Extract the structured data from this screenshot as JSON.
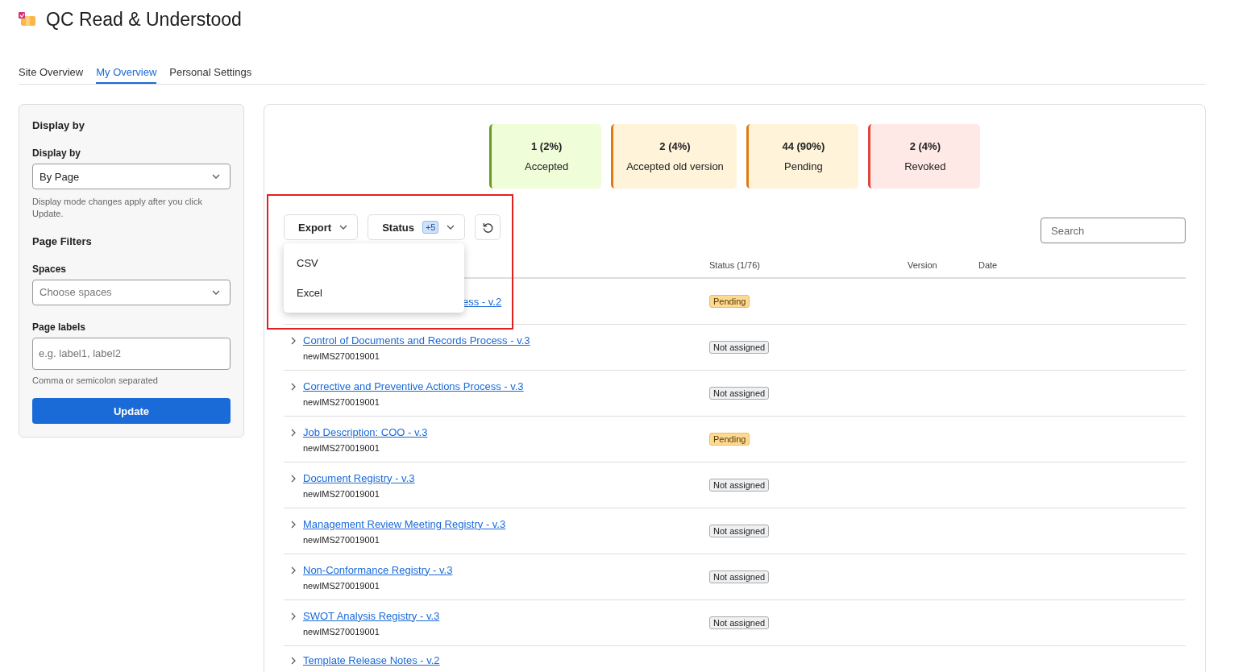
{
  "app": {
    "title": "QC Read & Understood"
  },
  "tabs": [
    {
      "label": "Site Overview",
      "selected": false
    },
    {
      "label": "My Overview",
      "selected": true
    },
    {
      "label": "Personal Settings",
      "selected": false
    }
  ],
  "sidebar": {
    "heading": "Display by",
    "display_label": "Display by",
    "display_value": "By Page",
    "display_hint": "Display mode changes apply after you click Update.",
    "filters_heading": "Page Filters",
    "spaces_label": "Spaces",
    "spaces_placeholder": "Choose spaces",
    "labels_label": "Page labels",
    "labels_placeholder": "e.g. label1, label2",
    "labels_hint": "Comma or semicolon separated",
    "update_button": "Update"
  },
  "stats": [
    {
      "count": "1 (2%)",
      "label": "Accepted",
      "kind": "accepted"
    },
    {
      "count": "2 (4%)",
      "label": "Accepted old version",
      "kind": "old"
    },
    {
      "count": "44 (90%)",
      "label": "Pending",
      "kind": "pending"
    },
    {
      "count": "2 (4%)",
      "label": "Revoked",
      "kind": "revoked"
    }
  ],
  "toolbar": {
    "export": "Export",
    "status": "Status",
    "status_count": "+5",
    "search_placeholder": "Search"
  },
  "export_menu": {
    "open": true,
    "items": [
      "CSV",
      "Excel"
    ]
  },
  "table": {
    "columns": [
      "Status (1/76)",
      "Version",
      "Date"
    ],
    "rows": [
      {
        "title": "ess - v.2",
        "partly_hidden": true,
        "status": "Pending",
        "kind": "pending"
      },
      {
        "title": "Control of Documents and Records Process - v.3",
        "space": "newIMS270019001",
        "status": "Not assigned",
        "kind": "unassigned"
      },
      {
        "title": "Corrective and Preventive Actions Process - v.3",
        "space": "newIMS270019001",
        "status": "Not assigned",
        "kind": "unassigned"
      },
      {
        "title": "Job Description: COO - v.3",
        "space": "newIMS270019001",
        "status": "Pending",
        "kind": "pending"
      },
      {
        "title": "Document Registry - v.3",
        "space": "newIMS270019001",
        "status": "Not assigned",
        "kind": "unassigned"
      },
      {
        "title": "Management Review Meeting Registry - v.3",
        "space": "newIMS270019001",
        "status": "Not assigned",
        "kind": "unassigned"
      },
      {
        "title": "Non-Conformance Registry - v.3",
        "space": "newIMS270019001",
        "status": "Not assigned",
        "kind": "unassigned"
      },
      {
        "title": "SWOT Analysis Registry - v.3",
        "space": "newIMS270019001",
        "status": "Not assigned",
        "kind": "unassigned"
      },
      {
        "title": "Template Release Notes - v.2"
      }
    ]
  }
}
